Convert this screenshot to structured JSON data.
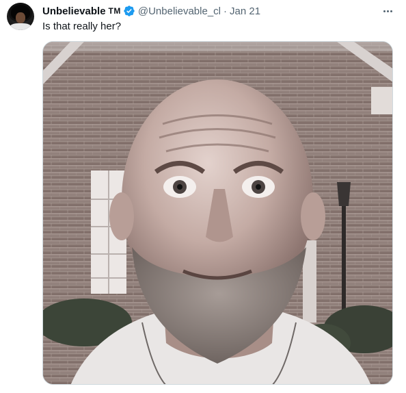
{
  "tweet": {
    "display_name": "Unbelievable",
    "badge_text": "TM",
    "handle": "@Unbelievable_cl",
    "separator": "·",
    "date": "Jan 21",
    "text": "Is that really her?",
    "verified_icon": "verified-badge-icon",
    "more_icon": "more-options-icon"
  },
  "media": {
    "description_icon": "photo"
  },
  "colors": {
    "primary_text": "#0f1419",
    "secondary_text": "#536471",
    "verified_blue": "#1d9bf0",
    "border": "#cfd9de"
  }
}
